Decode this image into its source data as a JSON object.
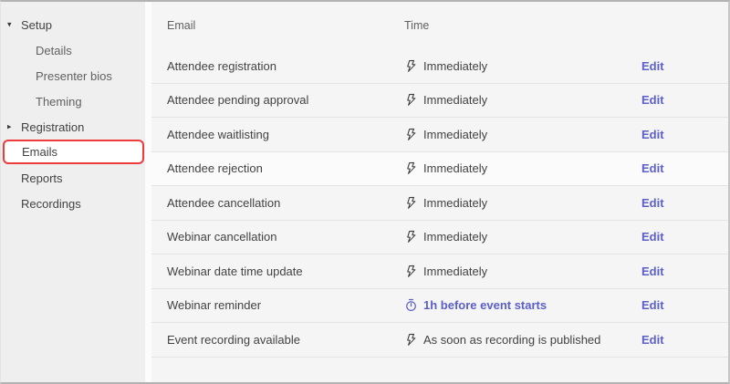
{
  "sidebar": {
    "items": [
      {
        "name": "setup",
        "label": "Setup",
        "indent": 0,
        "caret": "down",
        "selected": false
      },
      {
        "name": "details",
        "label": "Details",
        "indent": 1,
        "caret": null,
        "selected": false
      },
      {
        "name": "presenter-bios",
        "label": "Presenter bios",
        "indent": 1,
        "caret": null,
        "selected": false
      },
      {
        "name": "theming",
        "label": "Theming",
        "indent": 1,
        "caret": null,
        "selected": false
      },
      {
        "name": "registration",
        "label": "Registration",
        "indent": 0,
        "caret": "right",
        "selected": false
      },
      {
        "name": "emails",
        "label": "Emails",
        "indent": 0,
        "caret": null,
        "selected": true
      },
      {
        "name": "reports",
        "label": "Reports",
        "indent": 0,
        "caret": null,
        "selected": false
      },
      {
        "name": "recordings",
        "label": "Recordings",
        "indent": 0,
        "caret": null,
        "selected": false
      }
    ],
    "caret_glyphs": {
      "down": "▾",
      "right": "▸"
    }
  },
  "table": {
    "columns": [
      "Email",
      "Time"
    ],
    "edit_label": "Edit",
    "rows": [
      {
        "email": "Attendee registration",
        "time": "Immediately",
        "icon": "flash-icon",
        "accent": false,
        "highlight": false
      },
      {
        "email": "Attendee pending approval",
        "time": "Immediately",
        "icon": "flash-icon",
        "accent": false,
        "highlight": false
      },
      {
        "email": "Attendee waitlisting",
        "time": "Immediately",
        "icon": "flash-icon",
        "accent": false,
        "highlight": false
      },
      {
        "email": "Attendee rejection",
        "time": "Immediately",
        "icon": "flash-icon",
        "accent": false,
        "highlight": true
      },
      {
        "email": "Attendee cancellation",
        "time": "Immediately",
        "icon": "flash-icon",
        "accent": false,
        "highlight": false
      },
      {
        "email": "Webinar cancellation",
        "time": "Immediately",
        "icon": "flash-icon",
        "accent": false,
        "highlight": false
      },
      {
        "email": "Webinar date time update",
        "time": "Immediately",
        "icon": "flash-icon",
        "accent": false,
        "highlight": false
      },
      {
        "email": "Webinar reminder",
        "time": "1h before event starts",
        "icon": "timer-icon",
        "accent": true,
        "highlight": false
      },
      {
        "email": "Event recording available",
        "time": "As soon as recording is published",
        "icon": "flash-icon",
        "accent": false,
        "highlight": false
      }
    ]
  },
  "colors": {
    "accent": "#5b5fc7",
    "annotation": "#ee3b3b",
    "sidebar_bg": "#efefef",
    "main_bg": "#f5f5f5",
    "row_text": "#424242",
    "header_text": "#616161",
    "divider": "#e4e4e4"
  }
}
